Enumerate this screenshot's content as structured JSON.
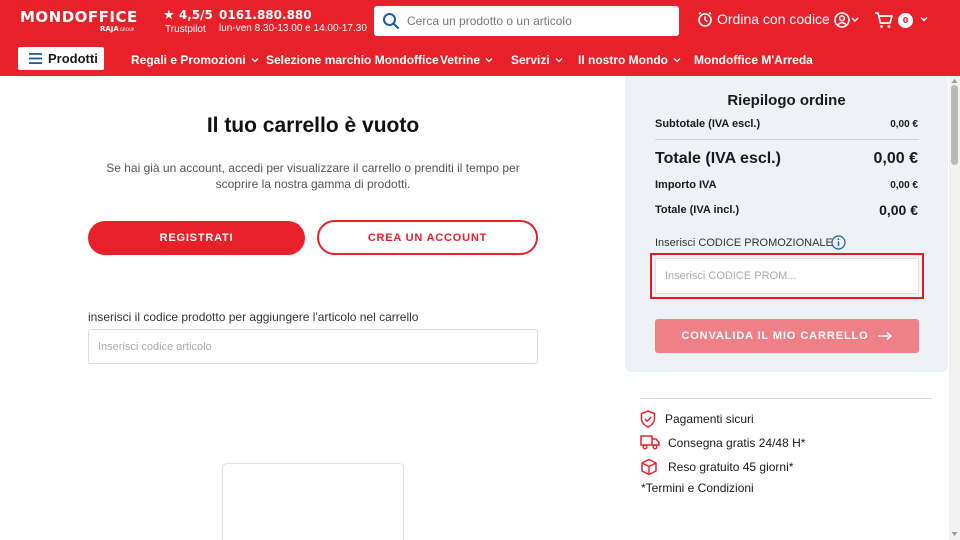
{
  "header": {
    "logo_main": "MONDOFFICE",
    "logo_sub": "RAJA",
    "logo_sub_small": "GROUP",
    "rating_value": "4,5/5",
    "rating_source": "Trustpilot",
    "phone": "0161.880.880",
    "hours": "lun-ven 8.30-13.00 e 14.00-17.30",
    "search_placeholder": "Cerca un prodotto o un articolo",
    "order_by_code": "Ordina con codice",
    "cart_count": "0"
  },
  "nav": {
    "products_button": "Prodotti",
    "items": [
      "Regali e Promozioni",
      "Selezione marchio Mondoffice",
      "Vetrine",
      "Servizi",
      "Il nostro Mondo",
      "Mondoffice M'Arreda"
    ]
  },
  "cart": {
    "empty_title": "Il tuo carrello è vuoto",
    "empty_desc": "Se hai già un account, accedi per visualizzare il carrello o prenditi il tempo per scoprire la nostra gamma di prodotti.",
    "register_button": "REGISTRATI",
    "create_account_button": "CREA UN ACCOUNT",
    "product_code_label": "inserisci il codice prodotto per aggiungere l'articolo nel carrello",
    "product_code_placeholder": "Inserisci codice articolo"
  },
  "summary": {
    "title": "Riepilogo ordine",
    "subtotal_label": "Subtotale (IVA escl.)",
    "subtotal_value": "0,00 €",
    "total_excl_label": "Totale (IVA escl.)",
    "total_excl_value": "0,00 €",
    "vat_label": "Importo IVA",
    "vat_value": "0,00 €",
    "total_incl_label": "Totale (IVA incl.)",
    "total_incl_value": "0,00 €",
    "promo_label": "Inserisci CODICE PROMOZIONALE",
    "promo_placeholder": "Inserisci CODICE PROM...",
    "validate_button": "CONVALIDA IL MIO CARRELLO"
  },
  "trust": {
    "payments": "Pagamenti sicuri",
    "delivery": "Consegna gratis 24/48 H*",
    "returns": "Reso gratuito 45 giorni*",
    "terms": "*Termini e Condizioni"
  },
  "colors": {
    "brand_red": "#e8202a",
    "summary_bg": "#eef1f6",
    "validate_disabled": "#f08088"
  },
  "icons": {
    "search": "search-icon",
    "clock": "clock-icon",
    "account": "user-circle-icon",
    "cart": "cart-icon",
    "info": "info-icon",
    "shield": "shield-check-icon",
    "truck": "truck-icon",
    "box": "box-return-icon",
    "arrow": "arrow-right-icon"
  }
}
